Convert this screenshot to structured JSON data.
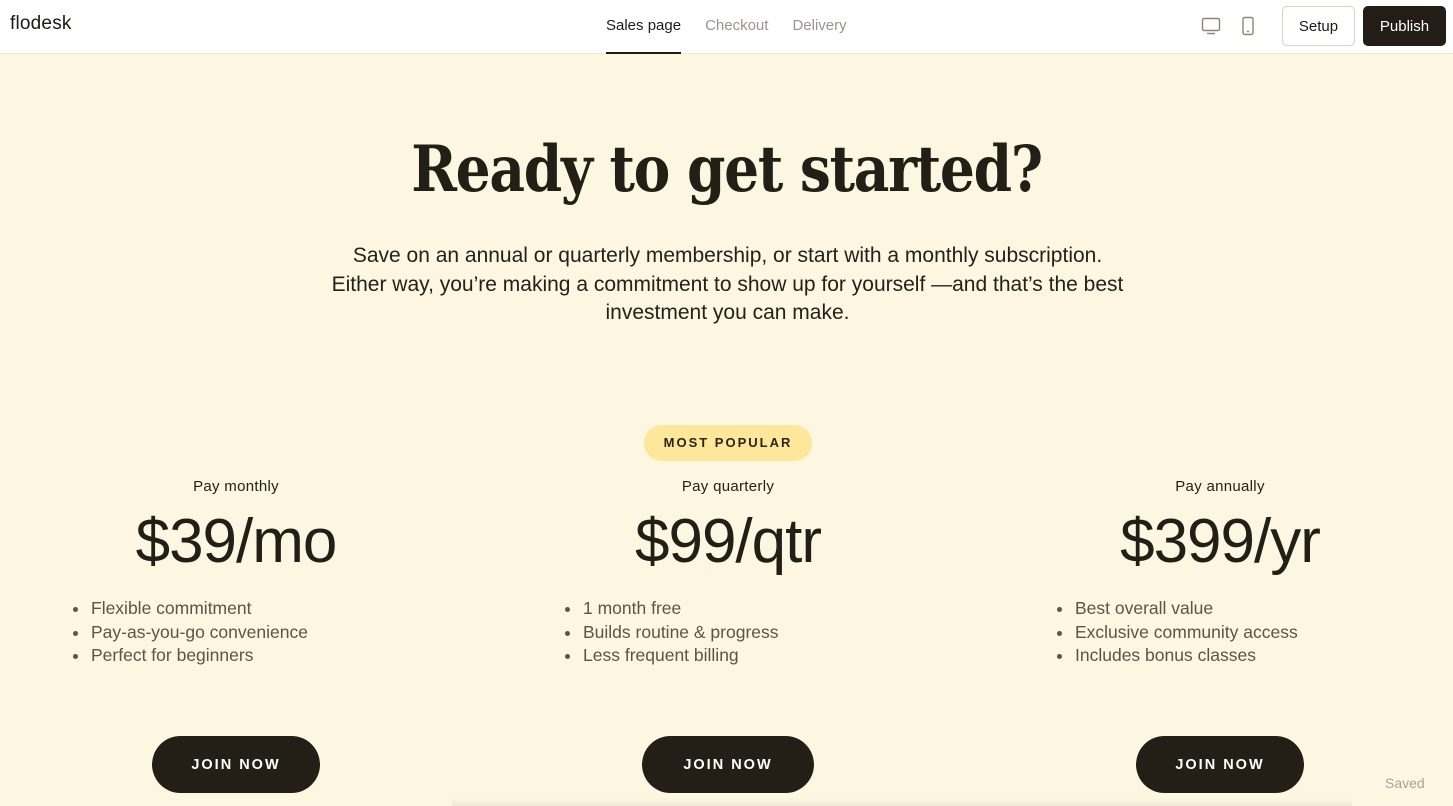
{
  "app": {
    "logo": "flodesk"
  },
  "tabs": [
    {
      "label": "Sales page",
      "active": true
    },
    {
      "label": "Checkout",
      "active": false
    },
    {
      "label": "Delivery",
      "active": false
    }
  ],
  "toolbar": {
    "desktop_icon": "desktop-icon",
    "mobile_icon": "mobile-icon",
    "setup_label": "Setup",
    "publish_label": "Publish"
  },
  "hero": {
    "headline": "Ready to get started?",
    "subtext": "Save on an annual or quarterly membership, or start with a monthly subscription. Either way, you’re making a commitment to show up for yourself —and that’s the best investment you can make."
  },
  "badge": "MOST POPULAR",
  "plans": [
    {
      "name": "Pay monthly",
      "price": "$39/mo",
      "features": [
        "Flexible commitment",
        "Pay-as-you-go convenience",
        "Perfect for beginners"
      ],
      "cta": "JOIN NOW"
    },
    {
      "name": "Pay quarterly",
      "price": "$99/qtr",
      "features": [
        "1 month free",
        "Builds routine & progress",
        "Less frequent billing"
      ],
      "cta": "JOIN NOW"
    },
    {
      "name": "Pay annually",
      "price": "$399/yr",
      "features": [
        "Best overall value",
        "Exclusive community access",
        "Includes bonus classes"
      ],
      "cta": "JOIN NOW"
    }
  ],
  "status": {
    "saved": "Saved"
  },
  "colors": {
    "background": "#fdf6e0",
    "accent_dark": "#231f17",
    "badge": "#fde79b"
  }
}
